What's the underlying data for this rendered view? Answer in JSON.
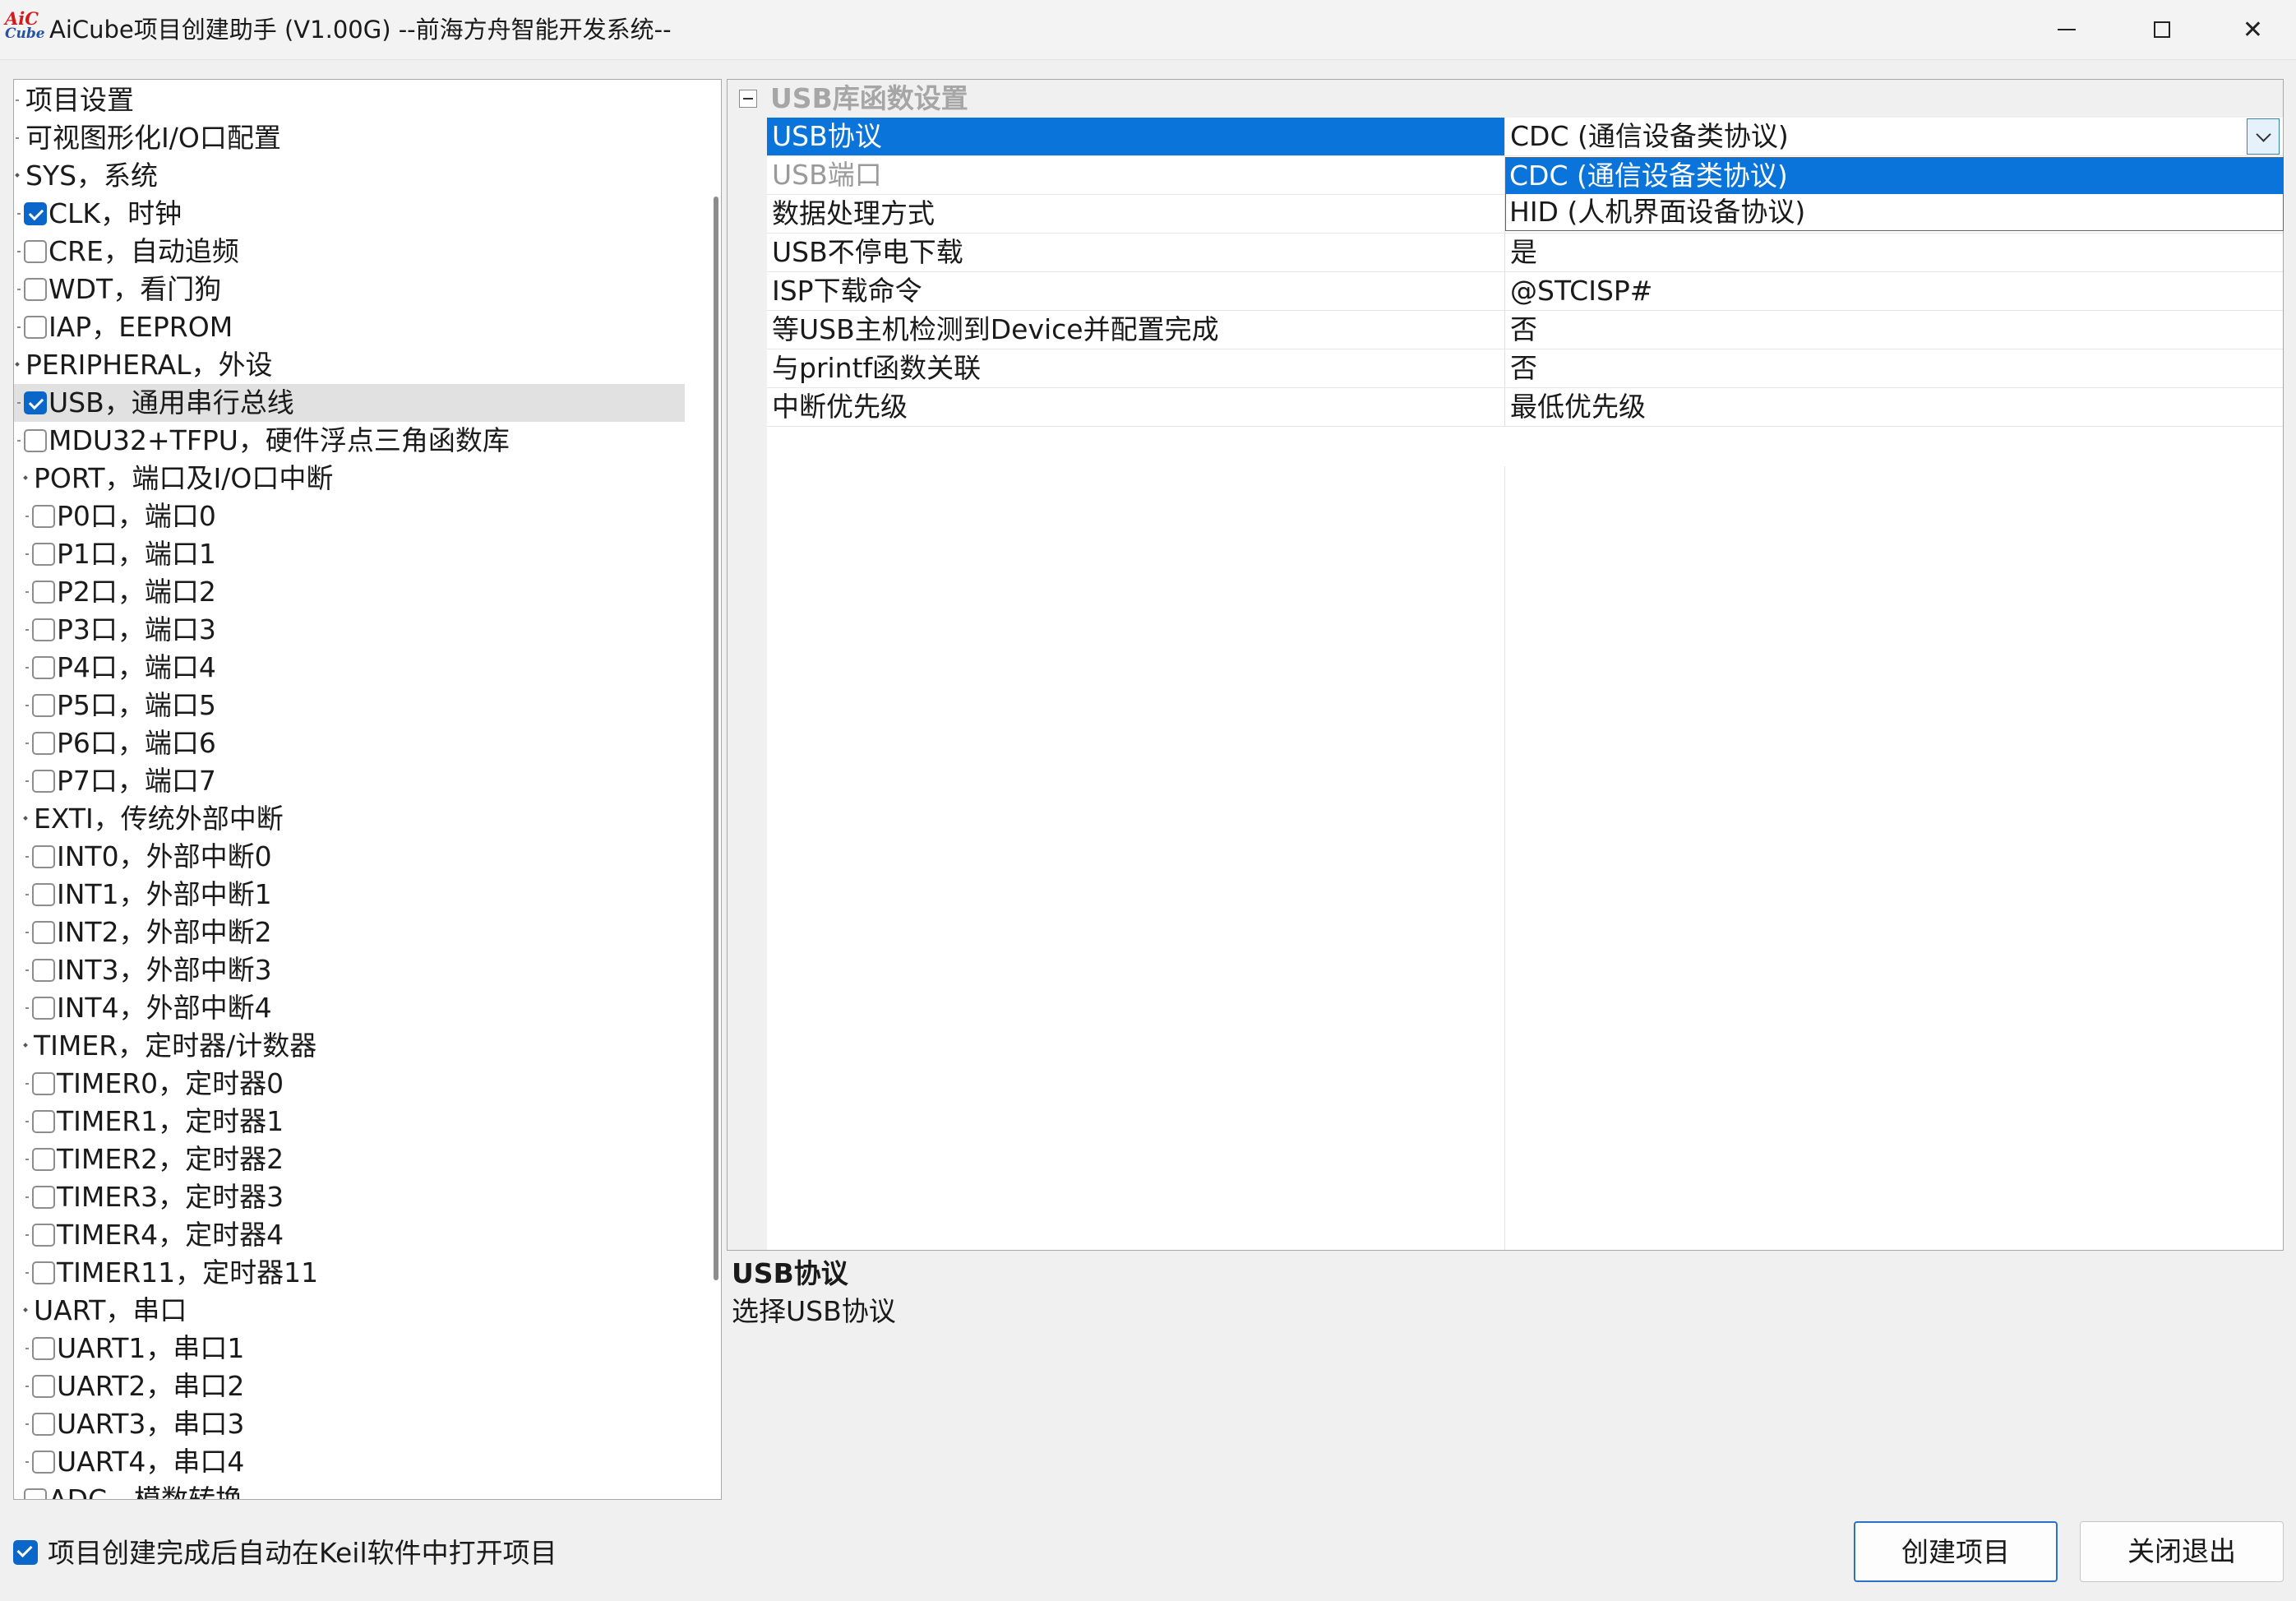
{
  "window": {
    "title": "AiCube项目创建助手 (V1.00G) --前海方舟智能开发系统--",
    "logo_top": "AiC",
    "logo_bottom": "Cube",
    "close_glyph": "✕"
  },
  "tree": {
    "items": [
      {
        "label": "项目设置",
        "level": 0,
        "kind": "node",
        "checked": false,
        "selected": false
      },
      {
        "label": "可视图形化I/O口配置",
        "level": 0,
        "kind": "node",
        "checked": false,
        "selected": false
      },
      {
        "label": "SYS，系统",
        "level": 0,
        "kind": "group",
        "checked": false,
        "selected": false
      },
      {
        "label": "CLK，时钟",
        "level": 1,
        "kind": "check",
        "checked": true,
        "selected": false
      },
      {
        "label": "CRE，自动追频",
        "level": 1,
        "kind": "check",
        "checked": false,
        "selected": false
      },
      {
        "label": "WDT，看门狗",
        "level": 1,
        "kind": "check",
        "checked": false,
        "selected": false
      },
      {
        "label": "IAP，EEPROM",
        "level": 1,
        "kind": "check",
        "checked": false,
        "selected": false
      },
      {
        "label": "PERIPHERAL，外设",
        "level": 0,
        "kind": "group",
        "checked": false,
        "selected": false
      },
      {
        "label": "USB，通用串行总线",
        "level": 1,
        "kind": "check",
        "checked": true,
        "selected": true
      },
      {
        "label": "MDU32+TFPU，硬件浮点三角函数库",
        "level": 1,
        "kind": "check",
        "checked": false,
        "selected": false
      },
      {
        "label": "PORT，端口及I/O口中断",
        "level": 1,
        "kind": "group",
        "checked": false,
        "selected": false
      },
      {
        "label": "P0口，端口0",
        "level": 2,
        "kind": "check",
        "checked": false,
        "selected": false
      },
      {
        "label": "P1口，端口1",
        "level": 2,
        "kind": "check",
        "checked": false,
        "selected": false
      },
      {
        "label": "P2口，端口2",
        "level": 2,
        "kind": "check",
        "checked": false,
        "selected": false
      },
      {
        "label": "P3口，端口3",
        "level": 2,
        "kind": "check",
        "checked": false,
        "selected": false
      },
      {
        "label": "P4口，端口4",
        "level": 2,
        "kind": "check",
        "checked": false,
        "selected": false
      },
      {
        "label": "P5口，端口5",
        "level": 2,
        "kind": "check",
        "checked": false,
        "selected": false
      },
      {
        "label": "P6口，端口6",
        "level": 2,
        "kind": "check",
        "checked": false,
        "selected": false
      },
      {
        "label": "P7口，端口7",
        "level": 2,
        "kind": "check",
        "checked": false,
        "selected": false
      },
      {
        "label": "EXTI，传统外部中断",
        "level": 1,
        "kind": "group",
        "checked": false,
        "selected": false
      },
      {
        "label": "INT0，外部中断0",
        "level": 2,
        "kind": "check",
        "checked": false,
        "selected": false
      },
      {
        "label": "INT1，外部中断1",
        "level": 2,
        "kind": "check",
        "checked": false,
        "selected": false
      },
      {
        "label": "INT2，外部中断2",
        "level": 2,
        "kind": "check",
        "checked": false,
        "selected": false
      },
      {
        "label": "INT3，外部中断3",
        "level": 2,
        "kind": "check",
        "checked": false,
        "selected": false
      },
      {
        "label": "INT4，外部中断4",
        "level": 2,
        "kind": "check",
        "checked": false,
        "selected": false
      },
      {
        "label": "TIMER，定时器/计数器",
        "level": 1,
        "kind": "group",
        "checked": false,
        "selected": false
      },
      {
        "label": "TIMER0，定时器0",
        "level": 2,
        "kind": "check",
        "checked": false,
        "selected": false
      },
      {
        "label": "TIMER1，定时器1",
        "level": 2,
        "kind": "check",
        "checked": false,
        "selected": false
      },
      {
        "label": "TIMER2，定时器2",
        "level": 2,
        "kind": "check",
        "checked": false,
        "selected": false
      },
      {
        "label": "TIMER3，定时器3",
        "level": 2,
        "kind": "check",
        "checked": false,
        "selected": false
      },
      {
        "label": "TIMER4，定时器4",
        "level": 2,
        "kind": "check",
        "checked": false,
        "selected": false
      },
      {
        "label": "TIMER11，定时器11",
        "level": 2,
        "kind": "check",
        "checked": false,
        "selected": false
      },
      {
        "label": "UART，串口",
        "level": 1,
        "kind": "group",
        "checked": false,
        "selected": false
      },
      {
        "label": "UART1，串口1",
        "level": 2,
        "kind": "check",
        "checked": false,
        "selected": false
      },
      {
        "label": "UART2，串口2",
        "level": 2,
        "kind": "check",
        "checked": false,
        "selected": false
      },
      {
        "label": "UART3，串口3",
        "level": 2,
        "kind": "check",
        "checked": false,
        "selected": false
      },
      {
        "label": "UART4，串口4",
        "level": 2,
        "kind": "check",
        "checked": false,
        "selected": false
      },
      {
        "label": "ADC，模数转换",
        "level": 1,
        "kind": "check",
        "checked": false,
        "selected": false
      }
    ]
  },
  "property_grid": {
    "category": "USB库函数设置",
    "rows": [
      {
        "name": "USB协议",
        "value": "CDC (通信设备类协议)",
        "state": "active"
      },
      {
        "name": "USB端口",
        "value": "",
        "state": "disabled"
      },
      {
        "name": "数据处理方式",
        "value": "",
        "state": "normal"
      },
      {
        "name": "USB不停电下载",
        "value": "是",
        "state": "normal"
      },
      {
        "name": "ISP下载命令",
        "value": "@STCISP#",
        "state": "normal"
      },
      {
        "name": "等USB主机检测到Device并配置完成",
        "value": "否",
        "state": "normal"
      },
      {
        "name": "与printf函数关联",
        "value": "否",
        "state": "normal"
      },
      {
        "name": "中断优先级",
        "value": "最低优先级",
        "state": "normal"
      }
    ],
    "dropdown": {
      "options": [
        "CDC (通信设备类协议)",
        "HID (人机界面设备协议)"
      ],
      "highlighted_index": 0
    }
  },
  "description": {
    "title": "USB协议",
    "text": "选择USB协议"
  },
  "footer": {
    "auto_open_label": "项目创建完成后自动在Keil软件中打开项目",
    "auto_open_checked": true,
    "create_label": "创建项目",
    "close_label": "关闭退出"
  },
  "colors": {
    "accent": "#0a74da",
    "checkbox_checked": "#0a66c9",
    "selected_row": "#e1e1e1",
    "logo_red": "#d21c1c",
    "logo_blue": "#2653a8"
  }
}
